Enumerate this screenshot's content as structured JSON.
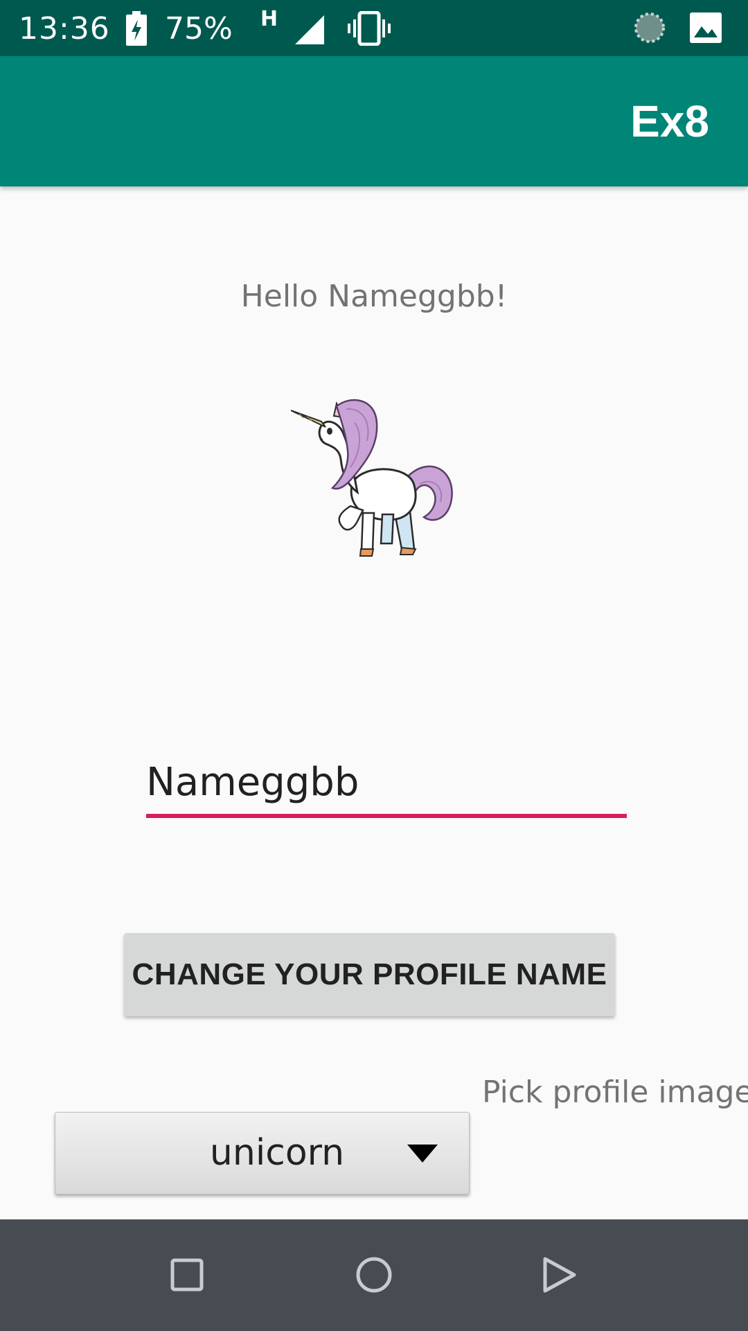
{
  "status_bar": {
    "time": "13:36",
    "battery": "75%",
    "network_type": "H",
    "icons": [
      "battery-charging-icon",
      "signal-icon",
      "vibrate-icon",
      "sync-icon",
      "image-icon"
    ]
  },
  "app_bar": {
    "title": "Ex8",
    "color": "#008577"
  },
  "content": {
    "greeting": "Hello Nameggbb!",
    "profile_image_icon": "unicorn-image",
    "name_field": {
      "value": "Nameggbb",
      "underline_color": "#d81b60"
    },
    "change_button_label": "CHANGE YOUR PROFILE NAME",
    "pick_label": "Pick profile image",
    "spinner": {
      "selected": "unicorn"
    }
  },
  "nav_bar": {
    "icons": [
      "recents-icon",
      "home-icon",
      "back-icon"
    ]
  }
}
